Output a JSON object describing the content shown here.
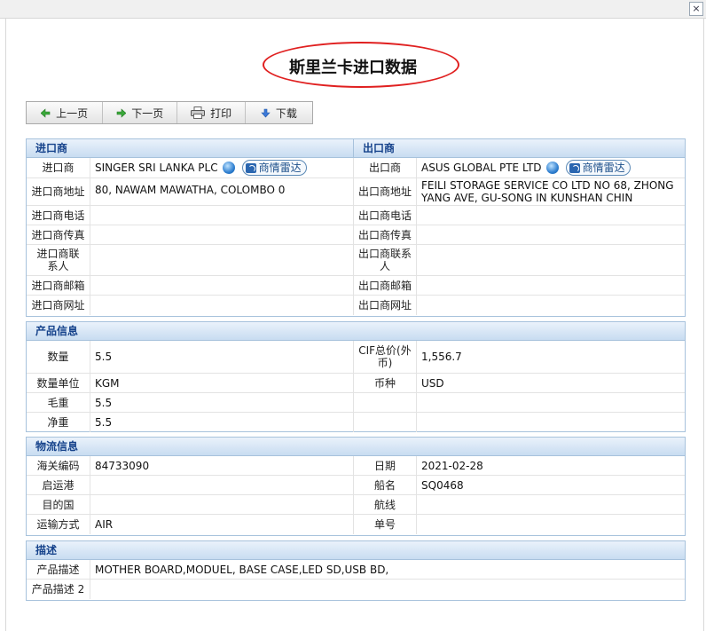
{
  "window": {
    "close_glyph": "×"
  },
  "title": "斯里兰卡进口数据",
  "toolbar": {
    "prev": "上一页",
    "next": "下一页",
    "print": "打印",
    "download": "下载"
  },
  "importer_section": {
    "header_left": "进口商",
    "header_right": "出口商",
    "radar_label": "商情雷达",
    "rows": [
      {
        "l_label": "进口商",
        "l_value": "SINGER SRI LANKA PLC",
        "r_label": "出口商",
        "r_value": "ASUS GLOBAL PTE LTD"
      },
      {
        "l_label": "进口商地址",
        "l_value": "80, NAWAM MAWATHA, COLOMBO 0",
        "r_label": "出口商地址",
        "r_value": "FEILI STORAGE SERVICE CO LTD NO 68, ZHONG YANG AVE, GU-SONG IN KUNSHAN CHIN"
      },
      {
        "l_label": "进口商电话",
        "l_value": "",
        "r_label": "出口商电话",
        "r_value": ""
      },
      {
        "l_label": "进口商传真",
        "l_value": "",
        "r_label": "出口商传真",
        "r_value": ""
      },
      {
        "l_label": "进口商联系人",
        "l_value": "",
        "r_label": "出口商联系人",
        "r_value": ""
      },
      {
        "l_label": "进口商邮箱",
        "l_value": "",
        "r_label": "出口商邮箱",
        "r_value": ""
      },
      {
        "l_label": "进口商网址",
        "l_value": "",
        "r_label": "出口商网址",
        "r_value": ""
      }
    ]
  },
  "product_section": {
    "header": "产品信息",
    "rows": [
      {
        "l_label": "数量",
        "l_value": "5.5",
        "r_label": "CIF总价(外币)",
        "r_value": "1,556.7"
      },
      {
        "l_label": "数量单位",
        "l_value": "KGM",
        "r_label": "币种",
        "r_value": "USD"
      },
      {
        "l_label": "毛重",
        "l_value": "5.5",
        "r_label": "",
        "r_value": ""
      },
      {
        "l_label": "净重",
        "l_value": "5.5",
        "r_label": "",
        "r_value": ""
      }
    ]
  },
  "logistics_section": {
    "header": "物流信息",
    "rows": [
      {
        "l_label": "海关编码",
        "l_value": "84733090",
        "r_label": "日期",
        "r_value": "2021-02-28"
      },
      {
        "l_label": "启运港",
        "l_value": "",
        "r_label": "船名",
        "r_value": "SQ0468"
      },
      {
        "l_label": "目的国",
        "l_value": "",
        "r_label": "航线",
        "r_value": ""
      },
      {
        "l_label": "运输方式",
        "l_value": "AIR",
        "r_label": "单号",
        "r_value": ""
      }
    ]
  },
  "description_section": {
    "header": "描述",
    "rows": [
      {
        "label": "产品描述",
        "value": "MOTHER BOARD,MODUEL, BASE CASE,LED SD,USB BD,"
      },
      {
        "label": "产品描述 2",
        "value": ""
      }
    ]
  }
}
